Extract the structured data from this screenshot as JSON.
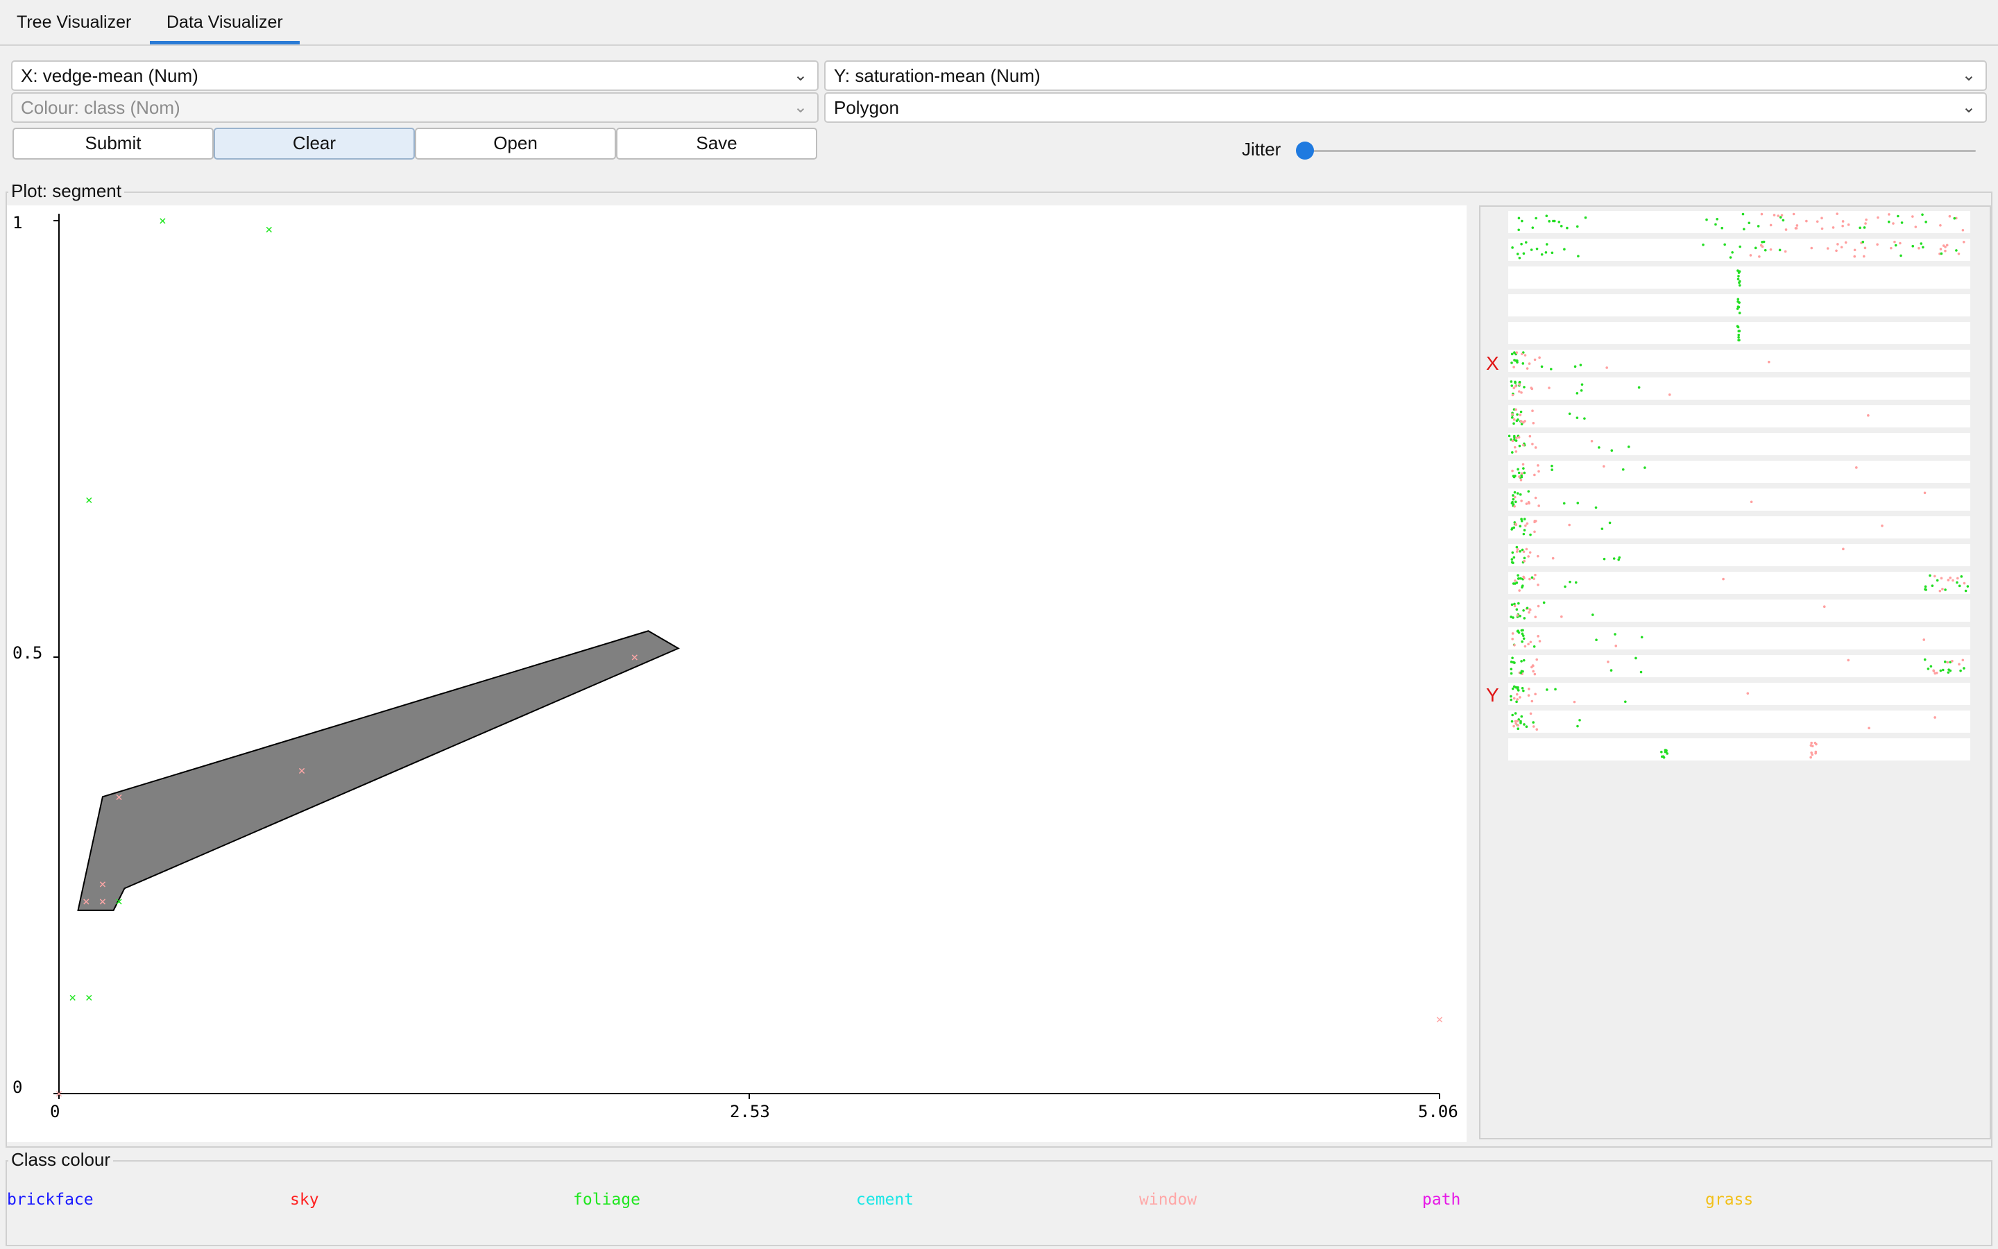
{
  "tabs": [
    {
      "label": "Tree Visualizer",
      "active": false
    },
    {
      "label": "Data Visualizer",
      "active": true
    }
  ],
  "controls": {
    "x_axis": "X: vedge-mean (Num)",
    "y_axis": "Y: saturation-mean (Num)",
    "colour": "Colour: class (Nom)",
    "shape": "Polygon",
    "buttons": {
      "submit": "Submit",
      "clear": "Clear",
      "open": "Open",
      "save": "Save"
    },
    "jitter_label": "Jitter",
    "jitter_value": 0
  },
  "plot": {
    "title": "Plot: segment",
    "y_ticks": [
      "1",
      "0.5",
      "0"
    ],
    "x_ticks": [
      "0",
      "2.53",
      "5.06"
    ]
  },
  "matrix": {
    "x_marker": "X",
    "y_marker": "Y"
  },
  "legend": {
    "title": "Class colour",
    "items": [
      {
        "label": "brickface",
        "color": "#1a1aff"
      },
      {
        "label": "sky",
        "color": "#ff2020"
      },
      {
        "label": "foliage",
        "color": "#1fe61f"
      },
      {
        "label": "cement",
        "color": "#19e6e6"
      },
      {
        "label": "window",
        "color": "#ffa7a7"
      },
      {
        "label": "path",
        "color": "#e619e6"
      },
      {
        "label": "grass",
        "color": "#f2c01a"
      }
    ]
  },
  "chart_data": {
    "type": "scatter",
    "title": "Plot: segment",
    "xlabel": "vedge-mean",
    "ylabel": "saturation-mean",
    "xlim": [
      0,
      5.06
    ],
    "ylim": [
      0,
      1
    ],
    "x_ticks": [
      0,
      2.53,
      5.06
    ],
    "y_ticks": [
      0,
      0.5,
      1
    ],
    "series": [
      {
        "name": "foliage",
        "color": "#1fe61f",
        "points": [
          [
            0.38,
            1.0
          ],
          [
            0.77,
            0.99
          ],
          [
            0.11,
            0.68
          ],
          [
            0.22,
            0.22
          ],
          [
            0.05,
            0.11
          ],
          [
            0.11,
            0.11
          ]
        ]
      },
      {
        "name": "window",
        "color": "#ffa7a7",
        "points": [
          [
            2.11,
            0.5
          ],
          [
            0.89,
            0.37
          ],
          [
            0.22,
            0.34
          ],
          [
            0.16,
            0.24
          ],
          [
            0.1,
            0.22
          ],
          [
            0.16,
            0.22
          ],
          [
            5.06,
            0.085
          ],
          [
            0.0,
            0.0
          ]
        ]
      }
    ],
    "polygon": [
      [
        0.07,
        0.21
      ],
      [
        0.2,
        0.21
      ],
      [
        0.24,
        0.235
      ],
      [
        2.27,
        0.51
      ],
      [
        2.16,
        0.53
      ],
      [
        0.16,
        0.34
      ]
    ]
  }
}
